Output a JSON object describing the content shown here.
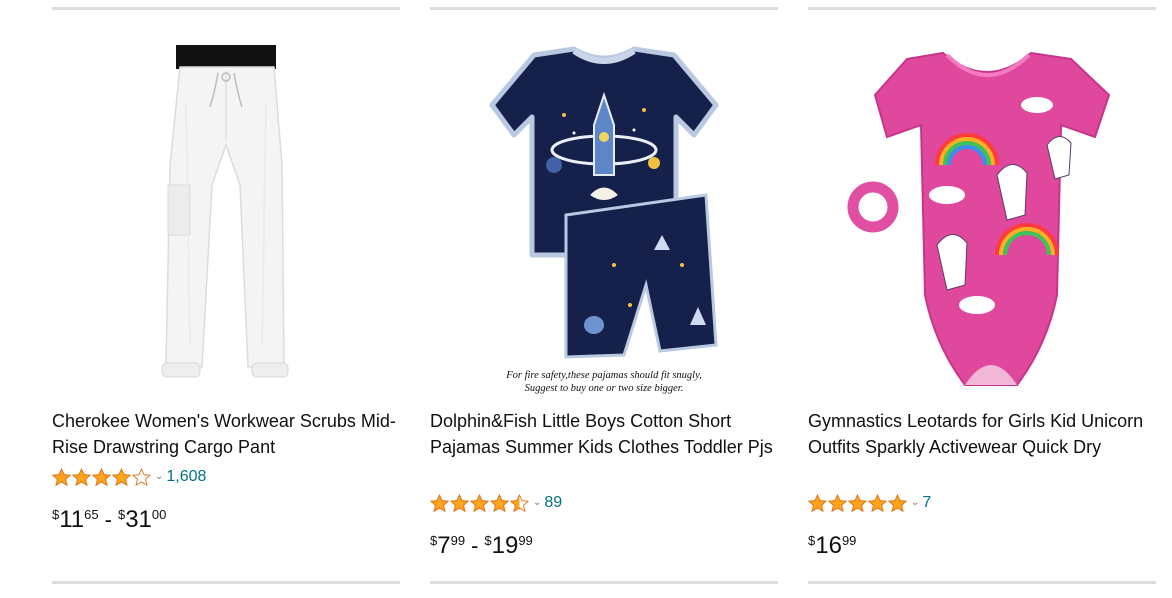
{
  "products": [
    {
      "title": "Cherokee Women's Workwear Scrubs Mid-Rise Drawstring Cargo Pant",
      "image_icon": "white-cargo-pant-image",
      "rating": 4.0,
      "review_count": "1,608",
      "price_low": {
        "symbol": "$",
        "whole": "11",
        "fraction": "65"
      },
      "price_high": {
        "symbol": "$",
        "whole": "31",
        "fraction": "00"
      },
      "dash": "-"
    },
    {
      "title": "Dolphin&Fish Little Boys Cotton Short Pajamas Summer Kids Clothes Toddler Pjs",
      "image_icon": "rocket-pajama-set-image",
      "image_caption_line1": "For fire safety,these pajamas should fit snugly,",
      "image_caption_line2": "Suggest to buy one or two size bigger.",
      "rating": 4.5,
      "review_count": "89",
      "price_low": {
        "symbol": "$",
        "whole": "7",
        "fraction": "99"
      },
      "price_high": {
        "symbol": "$",
        "whole": "19",
        "fraction": "99"
      },
      "dash": "-"
    },
    {
      "title": "Gymnastics Leotards for Girls Kid Unicorn Outfits Sparkly Activewear Quick Dry",
      "image_icon": "unicorn-leotard-image",
      "rating": 5.0,
      "review_count": "7",
      "price": {
        "symbol": "$",
        "whole": "16",
        "fraction": "99"
      }
    }
  ],
  "colors": {
    "star": "#FFA41C",
    "star_outline": "#DE7921",
    "link": "#007185",
    "divider": "#DDDDDD",
    "text": "#0F1111"
  }
}
